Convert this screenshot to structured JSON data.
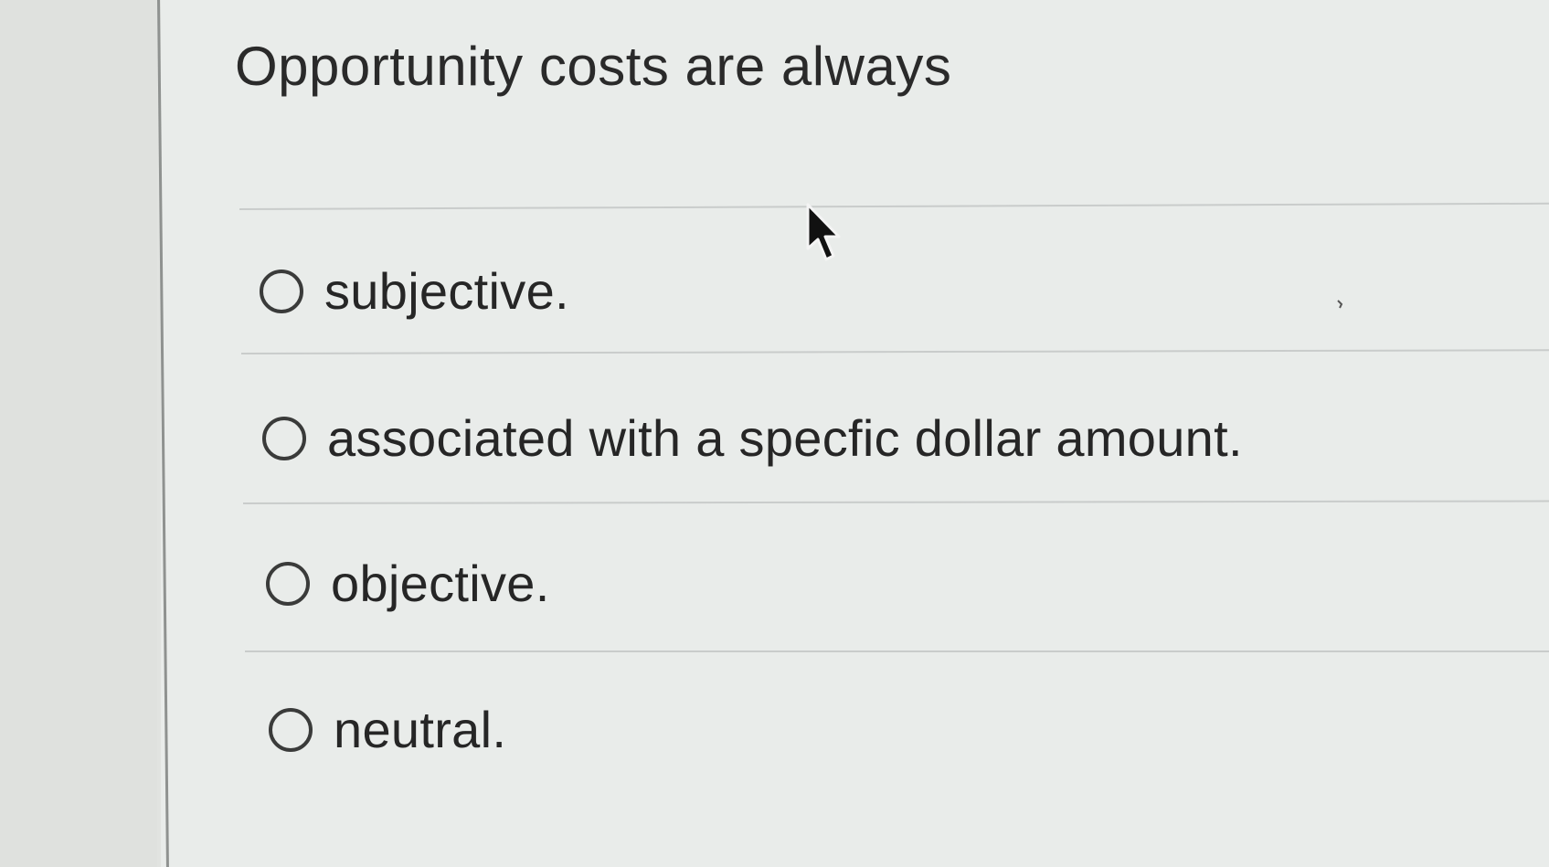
{
  "question": {
    "text": "Opportunity costs are always"
  },
  "options": [
    {
      "label": "subjective.",
      "selected": false
    },
    {
      "label": "associated with a specfic dollar amount.",
      "selected": false
    },
    {
      "label": "objective.",
      "selected": false
    },
    {
      "label": "neutral.",
      "selected": false
    }
  ],
  "colors": {
    "panel_background": "#e9ecea",
    "gutter_background": "#dfe1de",
    "divider": "#c9cccb",
    "text": "#262626",
    "radio_border": "#3a3b3a"
  },
  "icons": {
    "radio": "radio-unselected-icon",
    "pointer": "mouse-pointer-icon"
  }
}
